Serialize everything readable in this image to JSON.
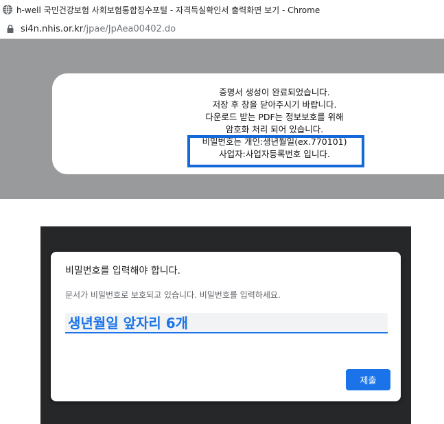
{
  "browser": {
    "window_title": "h-well 국민건강보험 사회보험통합징수포털 - 자격득실확인서 출력화면 보기 - Chrome",
    "url_host": "si4n.nhis.or.kr",
    "url_path": "/jpae/JpAea00402.do",
    "icons": {
      "favicon": "globe-icon",
      "security": "lock-icon"
    }
  },
  "notice": {
    "lines": [
      "증명서 생성이 완료되었습니다.",
      "저장 후 창을 닫아주시기 바랍니다.",
      "다운로드 받는 PDF는 정보보호를 위해",
      "암호화 처리 되어 있습니다.",
      "비밀번호는 개인:생년월일(ex.770101)",
      "사업자:사업자등록번호 입니다."
    ],
    "highlight_color": "#1468d8"
  },
  "pdf_dialog": {
    "title": "비밀번호를 입력해야 합니다.",
    "description": "문서가 비밀번호로 보호되고 있습니다. 비밀번호를 입력하세요.",
    "password_value": "생년월일 앞자리 6개",
    "submit_label": "제출",
    "accent_color": "#1a73e8"
  }
}
